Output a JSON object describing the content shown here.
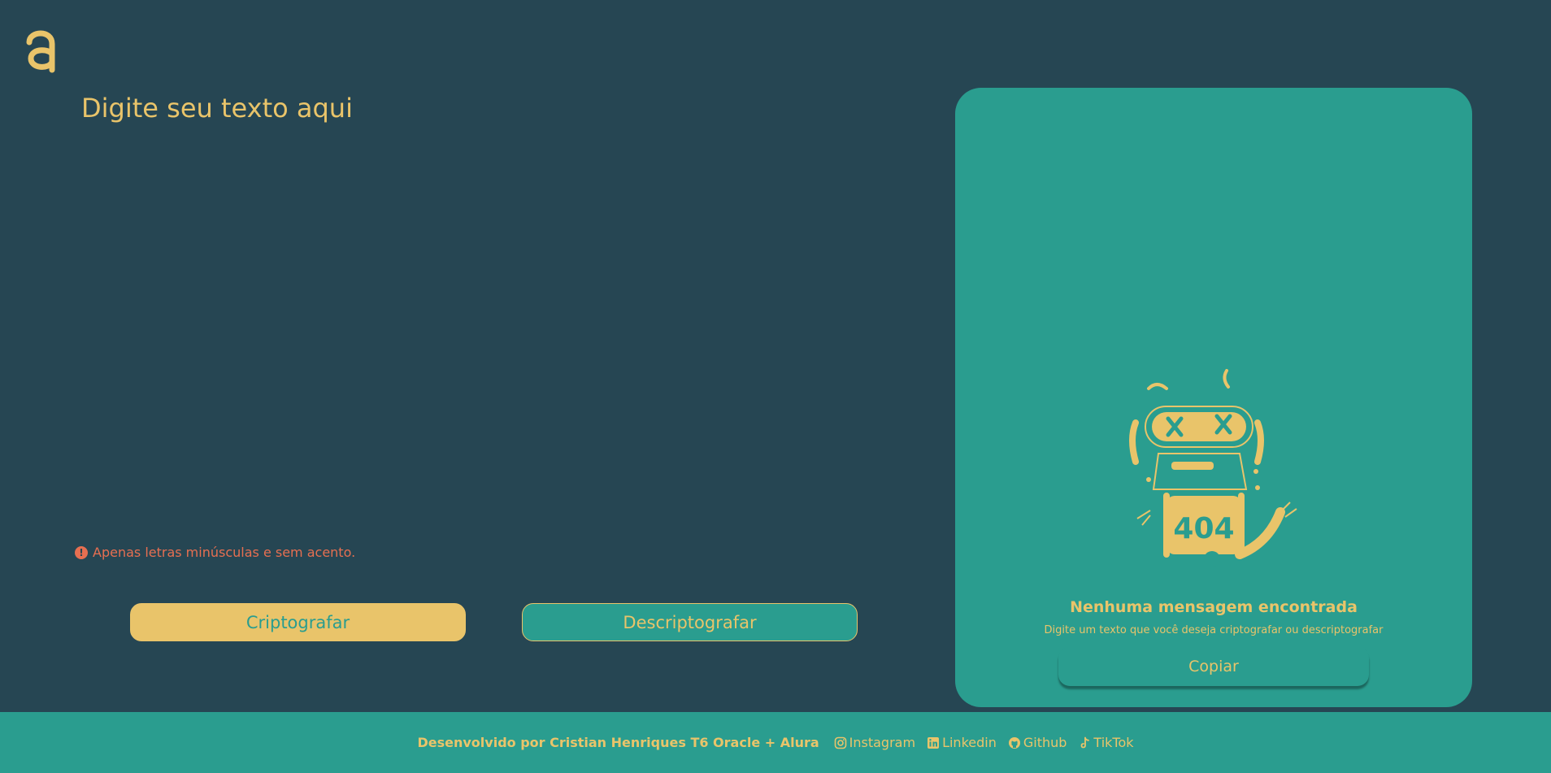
{
  "colors": {
    "background": "#264653",
    "panel": "#2a9d8f",
    "accent": "#e9c46a",
    "warning": "#e76f51"
  },
  "logo": {
    "icon": "alura-logo-icon"
  },
  "input": {
    "placeholder": "Digite seu texto aqui",
    "value": ""
  },
  "warning": {
    "icon": "exclamation-circle-icon",
    "text": "Apenas letras minúsculas e sem acento."
  },
  "buttons": {
    "encrypt": "Criptografar",
    "decrypt": "Descriptografar"
  },
  "output": {
    "illustration": "robot-404-icon",
    "title": "Nenhuma mensagem encontrada",
    "subtitle": "Digite um texto que você deseja criptografar ou descriptografar",
    "copy_label": "Copiar"
  },
  "footer": {
    "credit": "Desenvolvido por Cristian Henriques T6 Oracle + Alura",
    "links": [
      {
        "icon": "instagram-icon",
        "label": "Instagram"
      },
      {
        "icon": "linkedin-icon",
        "label": "Linkedin"
      },
      {
        "icon": "github-icon",
        "label": "Github"
      },
      {
        "icon": "tiktok-icon",
        "label": "TikTok"
      }
    ]
  }
}
